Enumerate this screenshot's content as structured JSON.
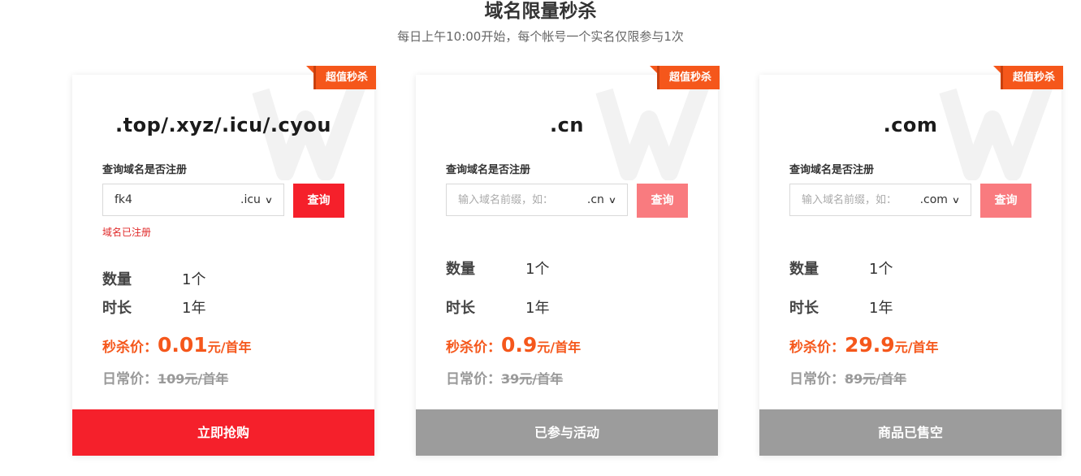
{
  "header": {
    "title": "域名限量秒杀",
    "subtitle": "每日上午10:00开始，每个帐号一个实名仅限参与1次"
  },
  "cards": [
    {
      "badge": "超值秒杀",
      "domain": ".top/.xyz/.icu/.cyou",
      "query_label": "查询域名是否注册",
      "input_value": "fk4",
      "input_placeholder": "",
      "suffix": ".icu",
      "query_button": "查询",
      "status_message": "域名已注册",
      "qty_label": "数量",
      "qty_value": "1个",
      "duration_label": "时长",
      "duration_value": "1年",
      "flash_label": "秒杀价：",
      "flash_price": "0.01",
      "flash_unit": "元/首年",
      "regular_label": "日常价：",
      "regular_price": "109元/首年",
      "action_button": "立即抢购"
    },
    {
      "badge": "超值秒杀",
      "domain": ".cn",
      "query_label": "查询域名是否注册",
      "input_value": "",
      "input_placeholder": "输入域名前缀，如：",
      "suffix": ".cn",
      "query_button": "查询",
      "status_message": "",
      "qty_label": "数量",
      "qty_value": "1个",
      "duration_label": "时长",
      "duration_value": "1年",
      "flash_label": "秒杀价：",
      "flash_price": "0.9",
      "flash_unit": "元/首年",
      "regular_label": "日常价：",
      "regular_price": "39元/首年",
      "action_button": "已参与活动"
    },
    {
      "badge": "超值秒杀",
      "domain": ".com",
      "query_label": "查询域名是否注册",
      "input_value": "",
      "input_placeholder": "输入域名前缀，如：",
      "suffix": ".com",
      "query_button": "查询",
      "status_message": "",
      "qty_label": "数量",
      "qty_value": "1个",
      "duration_label": "时长",
      "duration_value": "1年",
      "flash_label": "秒杀价：",
      "flash_price": "29.9",
      "flash_unit": "元/首年",
      "regular_label": "日常价：",
      "regular_price": "89元/首年",
      "action_button": "商品已售空"
    }
  ],
  "colors": {
    "accent_red": "#f5202b",
    "accent_red_light": "#f97b7f",
    "price_orange": "#f5571b",
    "disabled_gray": "#9c9c9c"
  }
}
